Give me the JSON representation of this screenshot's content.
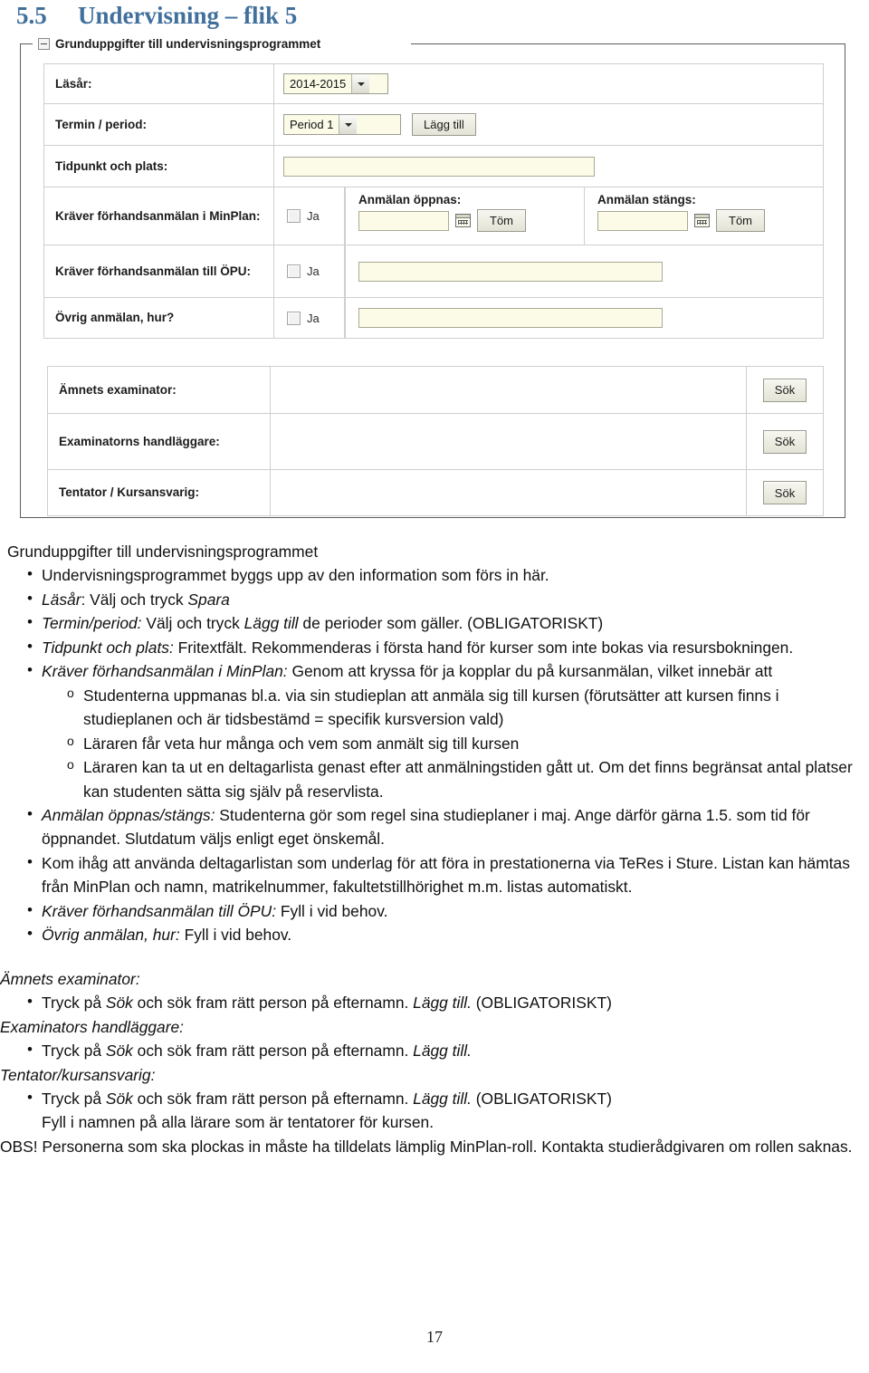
{
  "heading": {
    "number": "5.5",
    "text": "Undervisning – flik 5"
  },
  "form": {
    "legend": "Grunduppgifter till undervisningsprogrammet",
    "collapse_icon": "minus-box-icon",
    "rows": {
      "lasar": {
        "label": "Läsår:",
        "select_value": "2014-2015"
      },
      "termin": {
        "label": "Termin / period:",
        "select_value": "Period 1",
        "button": "Lägg till"
      },
      "tidpunkt": {
        "label": "Tidpunkt och plats:",
        "value": ""
      },
      "minplan": {
        "label": "Kräver förhandsanmälan i MinPlan:",
        "checkbox_label": "Ja",
        "open": {
          "title": "Anmälan öppnas:",
          "value": "",
          "calendar_icon": "calendar-icon",
          "clear_button": "Töm"
        },
        "close": {
          "title": "Anmälan stängs:",
          "value": "",
          "calendar_icon": "calendar-icon",
          "clear_button": "Töm"
        }
      },
      "opu": {
        "label": "Kräver förhandsanmälan till ÖPU:",
        "checkbox_label": "Ja",
        "value": ""
      },
      "ovrig": {
        "label": "Övrig anmälan, hur?",
        "checkbox_label": "Ja",
        "value": ""
      }
    },
    "person_rows": [
      {
        "label": "Ämnets examinator:",
        "value": "",
        "button": "Sök"
      },
      {
        "label": "Examinatorns handläggare:",
        "value": "",
        "button": "Sök"
      },
      {
        "label": "Tentator / Kursansvarig:",
        "value": "",
        "button": "Sök"
      }
    ]
  },
  "prose": {
    "section_title": "Grunduppgifter till undervisningsprogrammet",
    "b1": "Undervisningsprogrammet byggs upp av den information som förs in här.",
    "b2_em": "Läsår",
    "b2_a": ": Välj och tryck ",
    "b2_em2": "Spara",
    "b3_em": "Termin/period:",
    "b3_a": " Välj och tryck ",
    "b3_em2": "Lägg till",
    "b3_b": " de perioder som gäller. (OBLIGATORISKT)",
    "b4_em": "Tidpunkt och plats:",
    "b4_a": " Fritextfält. Rekommenderas i första hand för kurser som inte bokas via resursbokningen.",
    "b5_em": "Kräver förhandsanmälan i MinPlan:",
    "b5_a": " Genom att kryssa för ja kopplar du på kursanmälan, vilket innebär att",
    "s1": "Studenterna uppmanas bl.a. via sin studieplan att anmäla sig till kursen (förutsätter att kursen finns i studieplanen och är tidsbestämd = specifik kursversion vald)",
    "s2": "Läraren får veta hur många och vem som anmält sig till kursen",
    "s3": "Läraren kan ta ut en deltagarlista genast efter att anmälningstiden gått ut. Om det finns begränsat antal platser kan studenten sätta sig själv på reservlista.",
    "b6_em": "Anmälan öppnas/stängs:",
    "b6_a": " Studenterna gör som regel sina studieplaner i maj. Ange därför gärna 1.5. som tid för öppnandet. Slutdatum väljs enligt eget önskemål.",
    "b7": "Kom ihåg att använda deltagarlistan som underlag för att föra in prestationerna via TeRes i Sture. Listan kan hämtas från MinPlan och namn, matrikelnummer, fakultetstillhörighet m.m. listas automatiskt.",
    "b8_em": "Kräver förhandsanmälan till ÖPU:",
    "b8_a": " Fyll i vid behov.",
    "b9_em": "Övrig anmälan, hur:",
    "b9_a": " Fyll i vid behov.",
    "h_examinator": "Ämnets examinator:",
    "e1_a": "Tryck på ",
    "e1_em": "Sök",
    "e1_b": " och sök fram rätt person på efternamn. ",
    "e1_em2": "Lägg till.",
    "e1_c": " (OBLIGATORISKT)",
    "h_handlaggare": "Examinators handläggare:",
    "e2_c": "",
    "h_tentator": "Tentator/kursansvarig:",
    "e3_c": " (OBLIGATORISKT)",
    "e3_extra": "Fyll i namnen på alla lärare som är tentatorer för kursen.",
    "obs": "OBS! Personerna som ska plockas in måste ha tilldelats lämplig MinPlan-roll. Kontakta studierådgivaren om rollen saknas."
  },
  "footer": {
    "page_number": "17"
  }
}
